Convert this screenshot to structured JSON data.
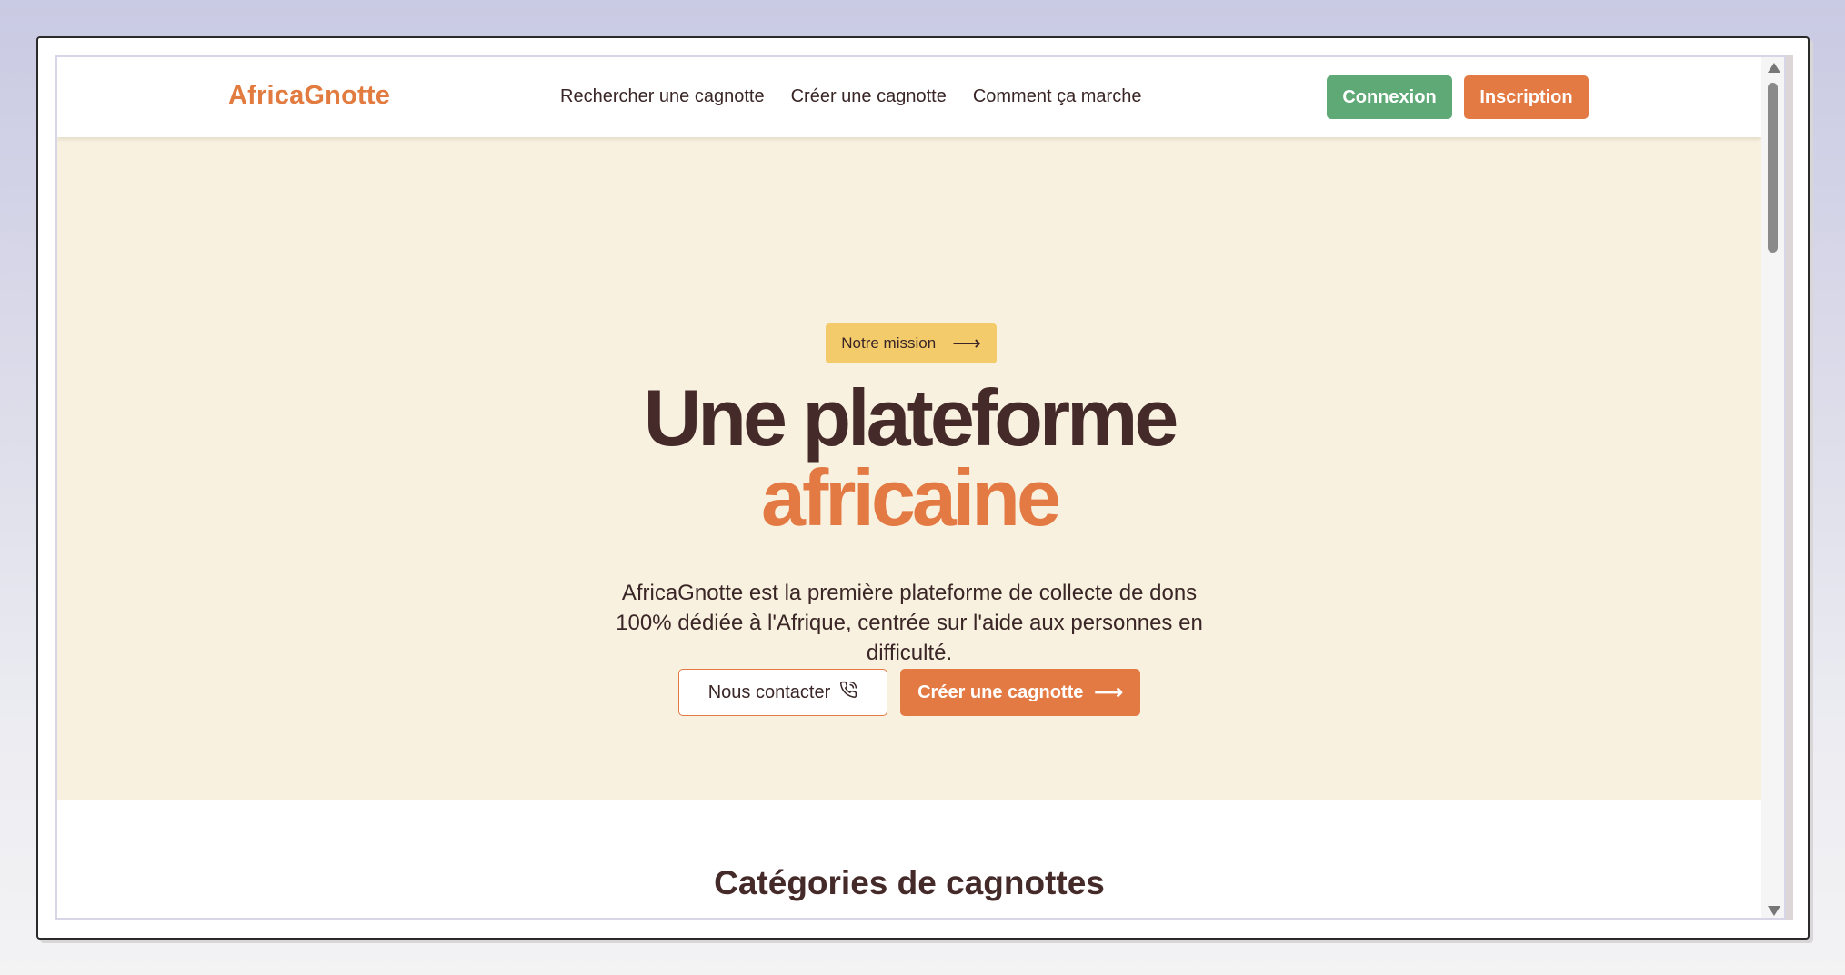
{
  "navbar": {
    "brand": "AfricaGnotte",
    "links": [
      "Rechercher une cagnotte",
      "Créer une cagnotte",
      "Comment ça marche"
    ],
    "login_label": "Connexion",
    "signup_label": "Inscription"
  },
  "hero": {
    "mission_label": "Notre mission",
    "mission_icon": "arrow-right-icon",
    "headline_line1": "Une plateforme",
    "headline_line2": "africaine",
    "subtitle": "AfricaGnotte est la première plateforme de collecte de dons 100% dédiée à l'Afrique, centrée sur l'aide aux personnes en difficulté.",
    "contact_label": "Nous contacter",
    "contact_icon": "phone-icon",
    "create_label": "Créer une cagnotte",
    "create_icon": "arrow-right-icon"
  },
  "categories": {
    "title": "Catégories de cagnottes"
  },
  "colors": {
    "brand_orange": "#e47a43",
    "login_green": "#5ea976",
    "mission_yellow": "#f3cb6b",
    "hero_background": "#f9f1df",
    "dark_text": "#452a2a"
  }
}
